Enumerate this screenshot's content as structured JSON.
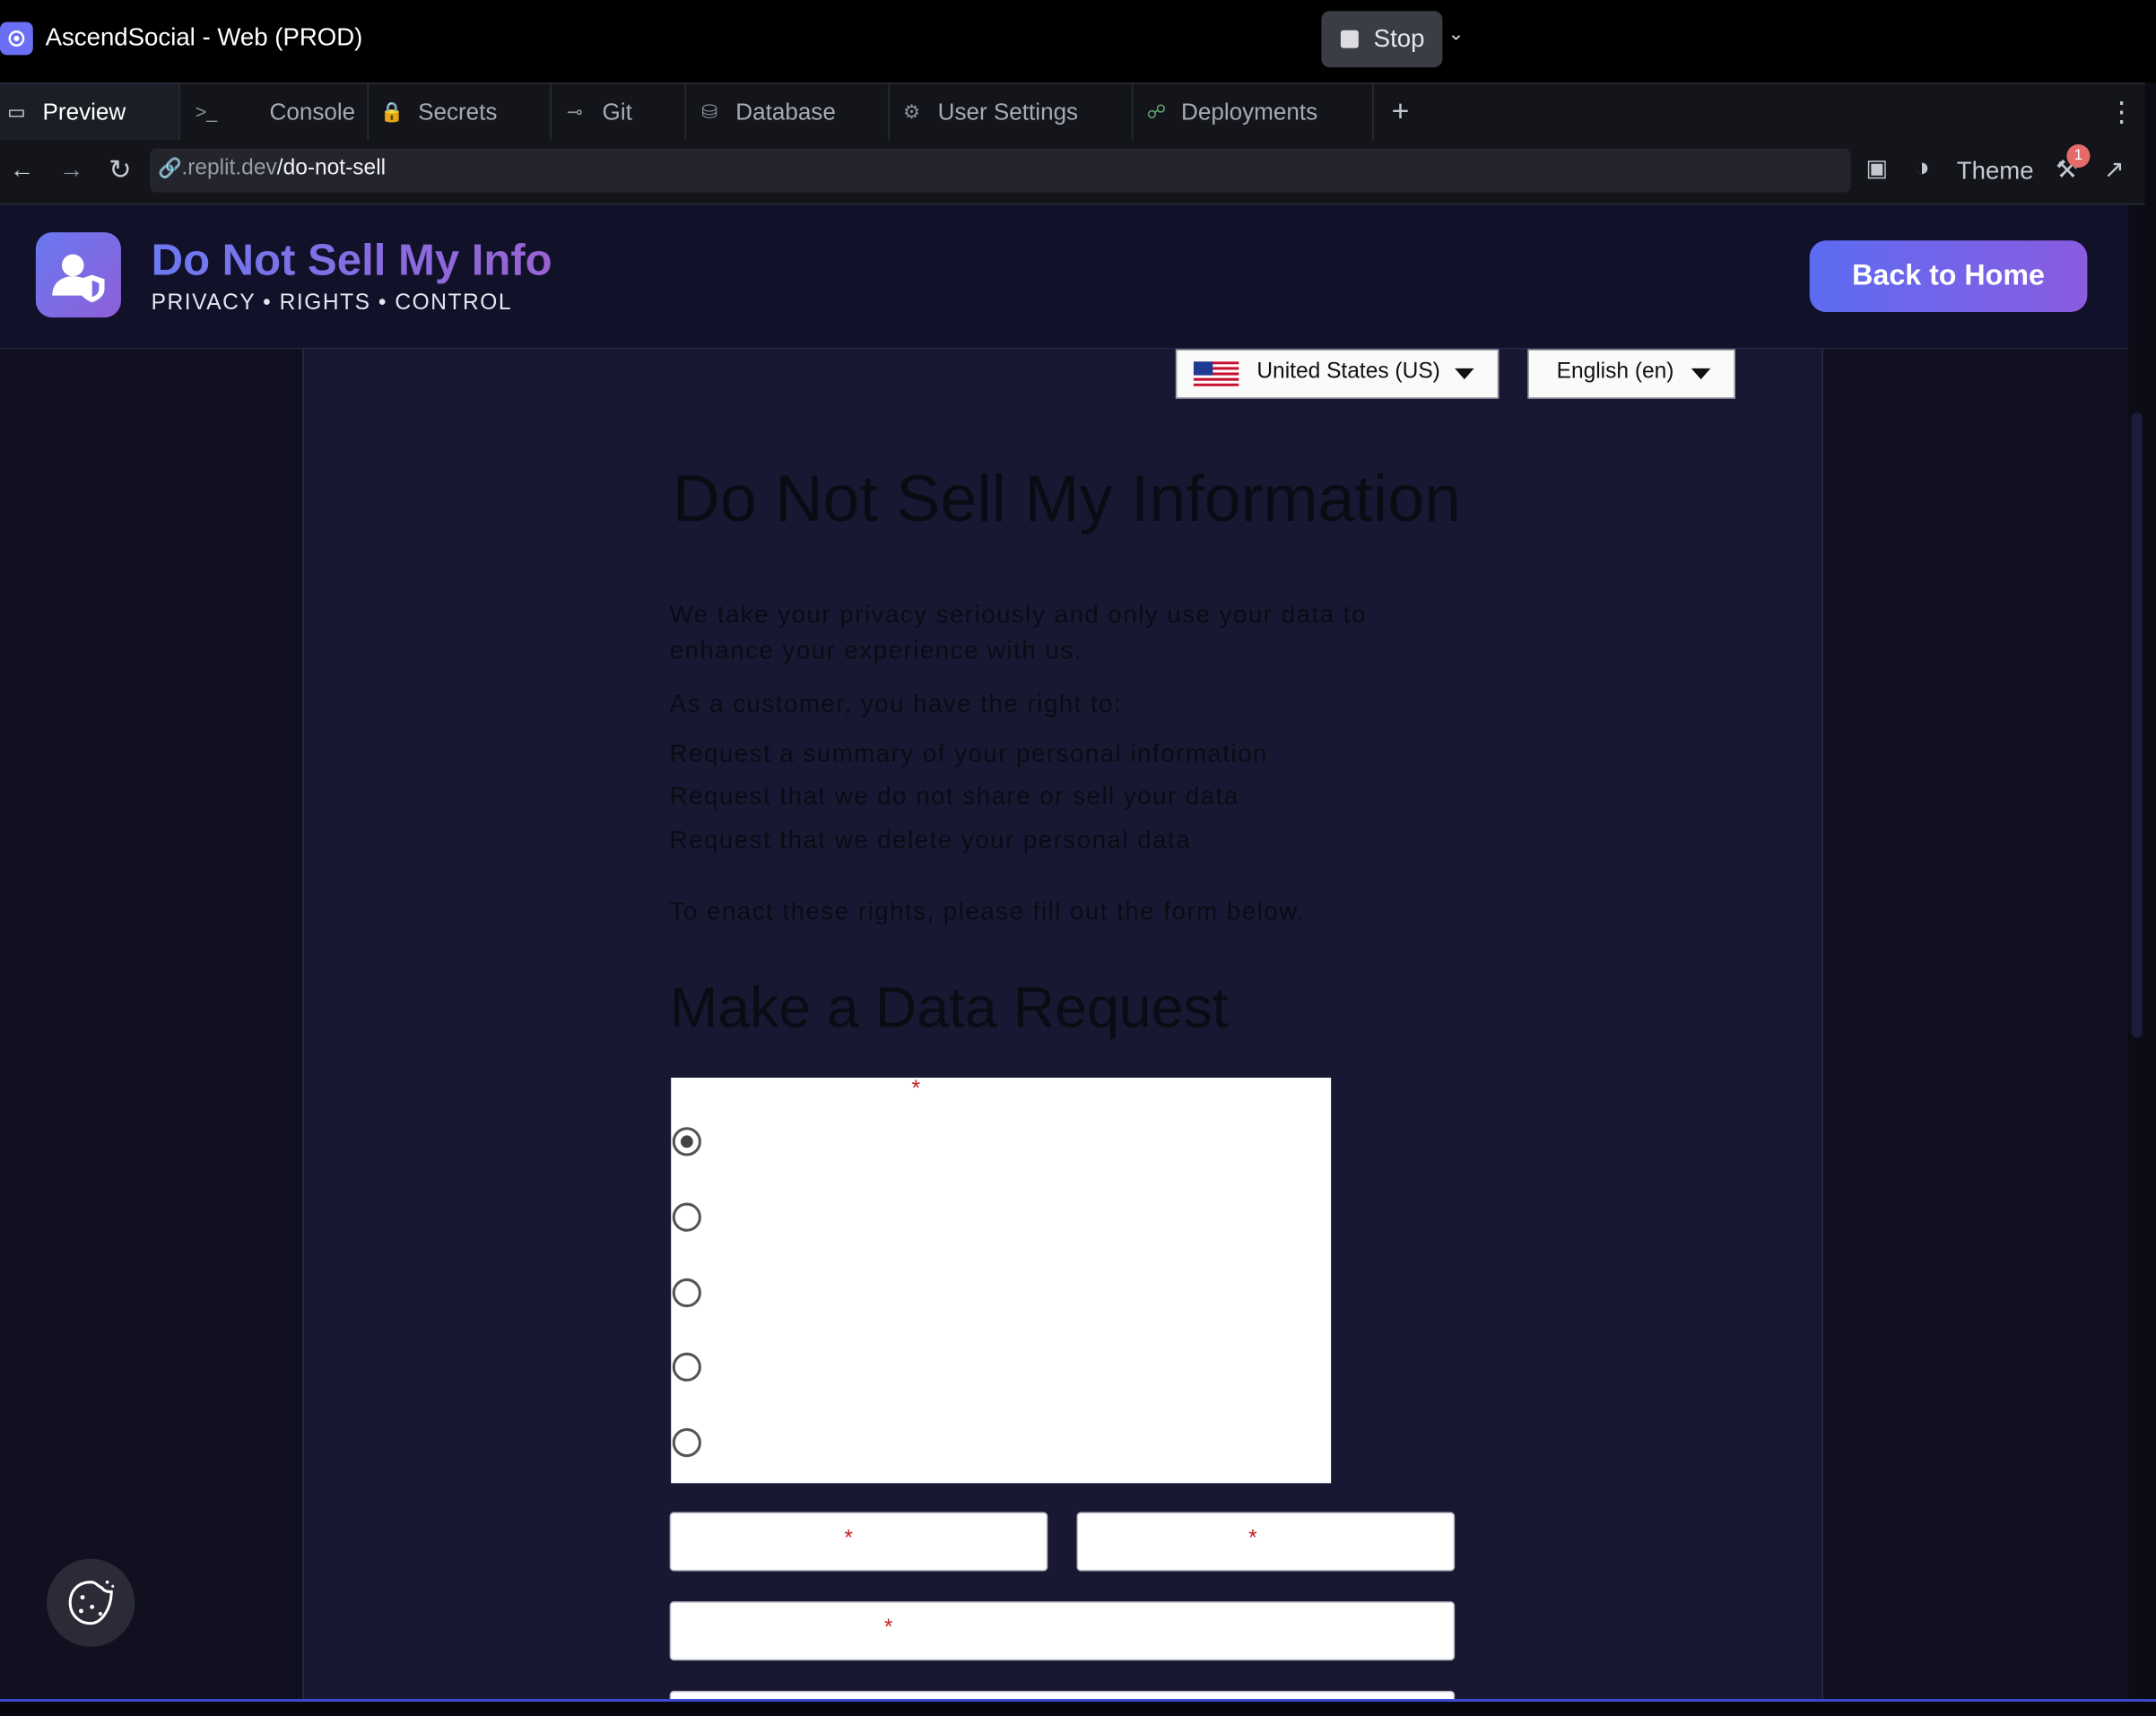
{
  "window": {
    "title": "AscendSocial - Web (PROD)",
    "stop_label": "Stop"
  },
  "tabs": [
    {
      "label": "Preview",
      "icon": "monitor-icon"
    },
    {
      "label": "Console",
      "icon": "terminal-icon"
    },
    {
      "label": "Secrets",
      "icon": "lock-icon"
    },
    {
      "label": "Git",
      "icon": "git-branch-icon"
    },
    {
      "label": "Database",
      "icon": "database-icon"
    },
    {
      "label": "User Settings",
      "icon": "gear-icon"
    },
    {
      "label": "Deployments",
      "icon": "deployments-icon"
    }
  ],
  "urlbar": {
    "host": ".replit.dev",
    "path": "/do-not-sell",
    "theme_label": "Theme",
    "badge_count": "1"
  },
  "site": {
    "title": "Do Not Sell My Info",
    "tagline": "PRIVACY • RIGHTS • CONTROL",
    "back_button": "Back to Home",
    "country_select": "United States (US)",
    "language_select": "English (en)"
  },
  "content": {
    "heading": "Do Not Sell My Information",
    "intro": "We take your privacy seriously and only use your data to enhance your experience with us.",
    "rights_intro": "As a customer, you have the right to:",
    "rights": [
      "Request a summary of your personal information",
      "Request that we do not share or sell your data",
      "Request that we delete your personal data"
    ],
    "enact": "To enact these rights, please fill out the form below.",
    "form_heading": "Make a Data Request",
    "required_marker": "*"
  },
  "form": {
    "radio_selected_index": 0,
    "radio_count": 5
  },
  "colors": {
    "accent_start": "#5c6cf2",
    "accent_end": "#8a5ce0",
    "required": "#c41f1f",
    "page_bg": "#101020"
  }
}
